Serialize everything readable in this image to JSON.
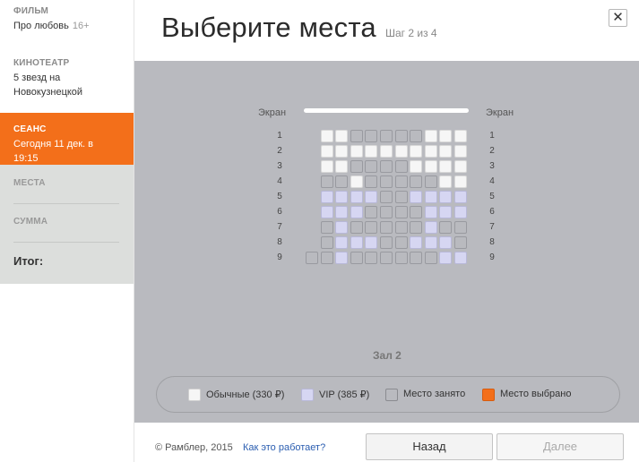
{
  "sidebar": {
    "film_label": "ФИЛЬМ",
    "film_value": "Про любовь",
    "film_age": "16+",
    "cinema_label": "КИНОТЕАТР",
    "cinema_value_line1": "5 звезд на",
    "cinema_value_line2": "Новокузнецкой",
    "session_label": "СЕАНС",
    "session_value": "Сегодня 11 дек. в 19:15",
    "seats_label": "МЕСТА",
    "sum_label": "СУММА",
    "total_label": "Итог:"
  },
  "header": {
    "title": "Выберите места",
    "step": "Шаг 2 из 4",
    "close": "✕"
  },
  "hall": {
    "screen_label": "Экран",
    "hall_name": "Зал 2",
    "row_numbers": [
      "1",
      "2",
      "3",
      "4",
      "5",
      "6",
      "7",
      "8",
      "9"
    ],
    "rows": [
      "-RRTTTTTRRR",
      "-RRRRRRRRRR",
      "-RRTTTTRRRR",
      "-TTRTTTTTRR",
      "-VVVVTTVVVV",
      "-VVVTTTTVVV",
      "-TVTTTTTVTT",
      "-TVVVTTVVVT",
      "TTVTTTTTTVV"
    ]
  },
  "legend": {
    "regular": "Обычные (330 ₽)",
    "vip": "VIP (385 ₽)",
    "taken": "Место занято",
    "selected": "Место выбрано"
  },
  "footer": {
    "copyright": "© Рамблер, 2015",
    "howto": "Как это работает?",
    "back": "Назад",
    "next": "Далее"
  }
}
